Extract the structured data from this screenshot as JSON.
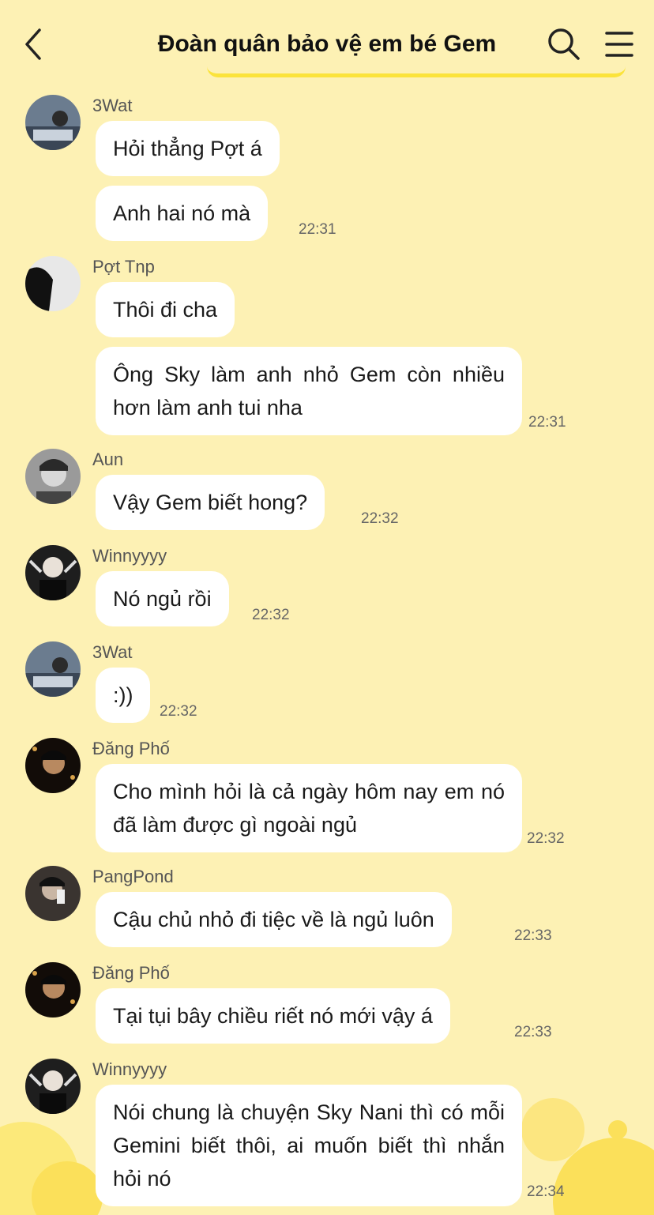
{
  "header": {
    "title": "Đoàn quân bảo vệ em bé Gem",
    "back_icon": "chevron-left-icon",
    "search_icon": "search-icon",
    "menu_icon": "hamburger-menu-icon"
  },
  "colors": {
    "background": "#fdf1b4",
    "bubble": "#ffffff",
    "accent": "#fbe33b"
  },
  "messages": [
    {
      "sender": "3Wat",
      "lines": [
        "Hỏi thẳng Pợt á",
        "Anh hai nó mà"
      ],
      "time": "22:31"
    },
    {
      "sender": "Pợt Tnp",
      "lines": [
        "Thôi đi cha",
        "Ông Sky làm anh nhỏ Gem còn nhiều hơn làm anh tui nha"
      ],
      "time": "22:31"
    },
    {
      "sender": "Aun",
      "lines": [
        "Vậy Gem biết hong?"
      ],
      "time": "22:32"
    },
    {
      "sender": "Winnyyyy",
      "lines": [
        "Nó ngủ rồi"
      ],
      "time": "22:32"
    },
    {
      "sender": "3Wat",
      "lines": [
        ":))"
      ],
      "time": "22:32"
    },
    {
      "sender": "Đăng Phố",
      "lines": [
        "Cho mình hỏi là cả ngày hôm nay em nó đã làm được gì ngoài ngủ"
      ],
      "time": "22:32"
    },
    {
      "sender": "PangPond",
      "lines": [
        "Cậu chủ nhỏ đi tiệc về là ngủ luôn"
      ],
      "time": "22:33"
    },
    {
      "sender": "Đăng Phố",
      "lines": [
        "Tại tụi bây chiều riết nó mới vậy á"
      ],
      "time": "22:33"
    },
    {
      "sender": "Winnyyyy",
      "lines": [
        "Nói chung là chuyện Sky Nani thì có mỗi Gemini biết thôi, ai muốn biết thì nhắn hỏi nó"
      ],
      "time": "22:34"
    }
  ]
}
